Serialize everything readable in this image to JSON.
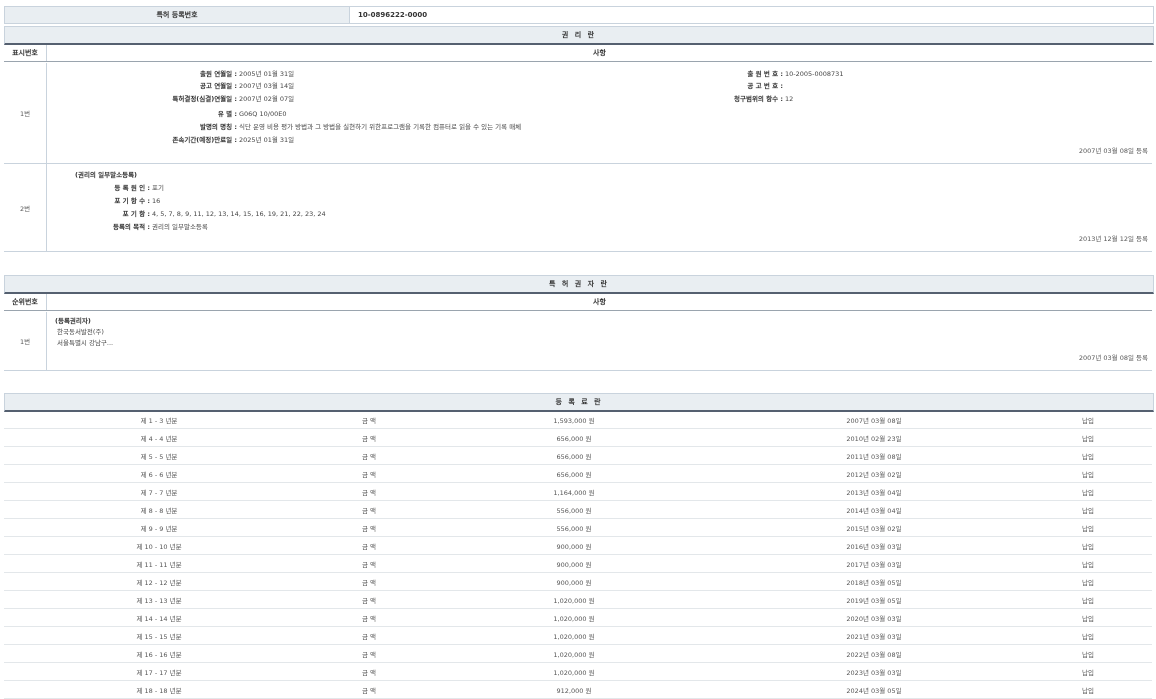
{
  "registration": {
    "label": "특허 등록번호",
    "value": "10-0896222-0000"
  },
  "rights": {
    "title": "권 리 란",
    "col_num": "표시번호",
    "col_detail": "사항",
    "entries": [
      {
        "num": "1번",
        "left_fields": [
          {
            "k": "출원 연월일 :",
            "v": "2005년 01월 31일"
          },
          {
            "k": "공고 연월일 :",
            "v": "2007년 03월 14일"
          },
          {
            "k": "특허결정(심결)연월일 :",
            "v": "2007년 02월 07일"
          },
          {
            "k": "유 별 :",
            "v": "G06Q 10/00E0"
          },
          {
            "k": "발명의 명칭 :",
            "v": "식단 운영 비용 평가 방법과 그 방법을 실현하기 위한프로그램을 기록한 컴퓨터로 읽을 수 있는 기록 매체"
          },
          {
            "k": "존속기간(예정)만료일 :",
            "v": "2025년 01월 31일"
          }
        ],
        "right_fields": [
          {
            "k": "출 원 번 호 :",
            "v": "10-2005-0008731"
          },
          {
            "k": "공 고 번 호 :",
            "v": ""
          },
          {
            "k": "청구범위의 항수 :",
            "v": "12"
          }
        ],
        "date": "2007년 03월 08일 등록"
      },
      {
        "num": "2번",
        "heading": "(권리의 일부말소등록)",
        "fields": [
          {
            "k": "등 록 원 인 :",
            "v": "포기"
          },
          {
            "k": "포 기 항 수 :",
            "v": "16"
          },
          {
            "k": "포 기 항 :",
            "v": "4, 5, 7, 8, 9, 11, 12, 13, 14, 15, 16, 19, 21, 22, 23, 24"
          },
          {
            "k": "등록의 목적 :",
            "v": "권리의 일부말소등록"
          }
        ],
        "date": "2013년 12월 12일 등록"
      }
    ]
  },
  "owners": {
    "title": "특 허 권 자 란",
    "col_num": "순위번호",
    "col_detail": "사항",
    "entries": [
      {
        "num": "1번",
        "heading": "(등록권리자)",
        "lines": [
          "한국동서발전(주)",
          "서울특별시 강남구..."
        ],
        "date": "2007년 03월 08일 등록"
      }
    ]
  },
  "fees": {
    "title": "등 록 료 란",
    "rows": [
      {
        "period": "제 1 - 3 년분",
        "label": "금 액",
        "amount": "1,593,000 원",
        "date": "2007년 03월 08일",
        "status": "납입"
      },
      {
        "period": "제 4 - 4 년분",
        "label": "금 액",
        "amount": "656,000 원",
        "date": "2010년 02월 23일",
        "status": "납입"
      },
      {
        "period": "제 5 - 5 년분",
        "label": "금 액",
        "amount": "656,000 원",
        "date": "2011년 03월 08일",
        "status": "납입"
      },
      {
        "period": "제 6 - 6 년분",
        "label": "금 액",
        "amount": "656,000 원",
        "date": "2012년 03월 02일",
        "status": "납입"
      },
      {
        "period": "제 7 - 7 년분",
        "label": "금 액",
        "amount": "1,164,000 원",
        "date": "2013년 03월 04일",
        "status": "납입"
      },
      {
        "period": "제 8 - 8 년분",
        "label": "금 액",
        "amount": "556,000 원",
        "date": "2014년 03월 04일",
        "status": "납입"
      },
      {
        "period": "제 9 - 9 년분",
        "label": "금 액",
        "amount": "556,000 원",
        "date": "2015년 03월 02일",
        "status": "납입"
      },
      {
        "period": "제 10 - 10 년분",
        "label": "금 액",
        "amount": "900,000 원",
        "date": "2016년 03월 03일",
        "status": "납입"
      },
      {
        "period": "제 11 - 11 년분",
        "label": "금 액",
        "amount": "900,000 원",
        "date": "2017년 03월 03일",
        "status": "납입"
      },
      {
        "period": "제 12 - 12 년분",
        "label": "금 액",
        "amount": "900,000 원",
        "date": "2018년 03월 05일",
        "status": "납입"
      },
      {
        "period": "제 13 - 13 년분",
        "label": "금 액",
        "amount": "1,020,000 원",
        "date": "2019년 03월 05일",
        "status": "납입"
      },
      {
        "period": "제 14 - 14 년분",
        "label": "금 액",
        "amount": "1,020,000 원",
        "date": "2020년 03월 03일",
        "status": "납입"
      },
      {
        "period": "제 15 - 15 년분",
        "label": "금 액",
        "amount": "1,020,000 원",
        "date": "2021년 03월 03일",
        "status": "납입"
      },
      {
        "period": "제 16 - 16 년분",
        "label": "금 액",
        "amount": "1,020,000 원",
        "date": "2022년 03월 08일",
        "status": "납입"
      },
      {
        "period": "제 17 - 17 년분",
        "label": "금 액",
        "amount": "1,020,000 원",
        "date": "2023년 03월 03일",
        "status": "납입"
      },
      {
        "period": "제 18 - 18 년분",
        "label": "금 액",
        "amount": "912,000 원",
        "date": "2024년 03월 05일",
        "status": "납입"
      }
    ]
  }
}
